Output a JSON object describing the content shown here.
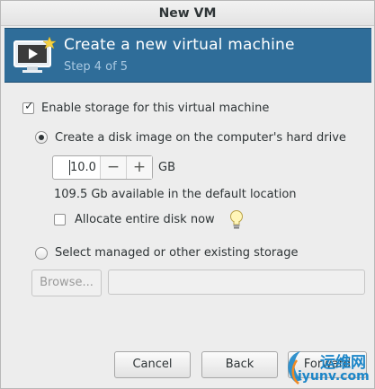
{
  "window": {
    "title": "New VM"
  },
  "banner": {
    "title": "Create a new virtual machine",
    "step": "Step 4 of 5",
    "icon": "monitor-play-icon"
  },
  "storage": {
    "enable_label": "Enable storage for this virtual machine",
    "enable_checked": true,
    "create_disk_label": "Create a disk image on the computer's hard drive",
    "create_disk_selected": true,
    "disk_size_value": "10.0",
    "disk_size_unit": "GB",
    "available_text": "109.5 Gb available in the default location",
    "allocate_label": "Allocate entire disk now",
    "allocate_checked": false,
    "managed_label": "Select managed or other existing storage",
    "managed_selected": false,
    "browse_label": "Browse...",
    "path_value": ""
  },
  "footer": {
    "cancel_label": "Cancel",
    "back_label": "Back",
    "forward_label": "Forward"
  },
  "watermark": {
    "cn_text": "运维网",
    "url_text": "iyunv.com"
  },
  "colors": {
    "banner_bg": "#2f6d99",
    "banner_step": "#a9c9e2",
    "watermark": "#1c86c8"
  }
}
